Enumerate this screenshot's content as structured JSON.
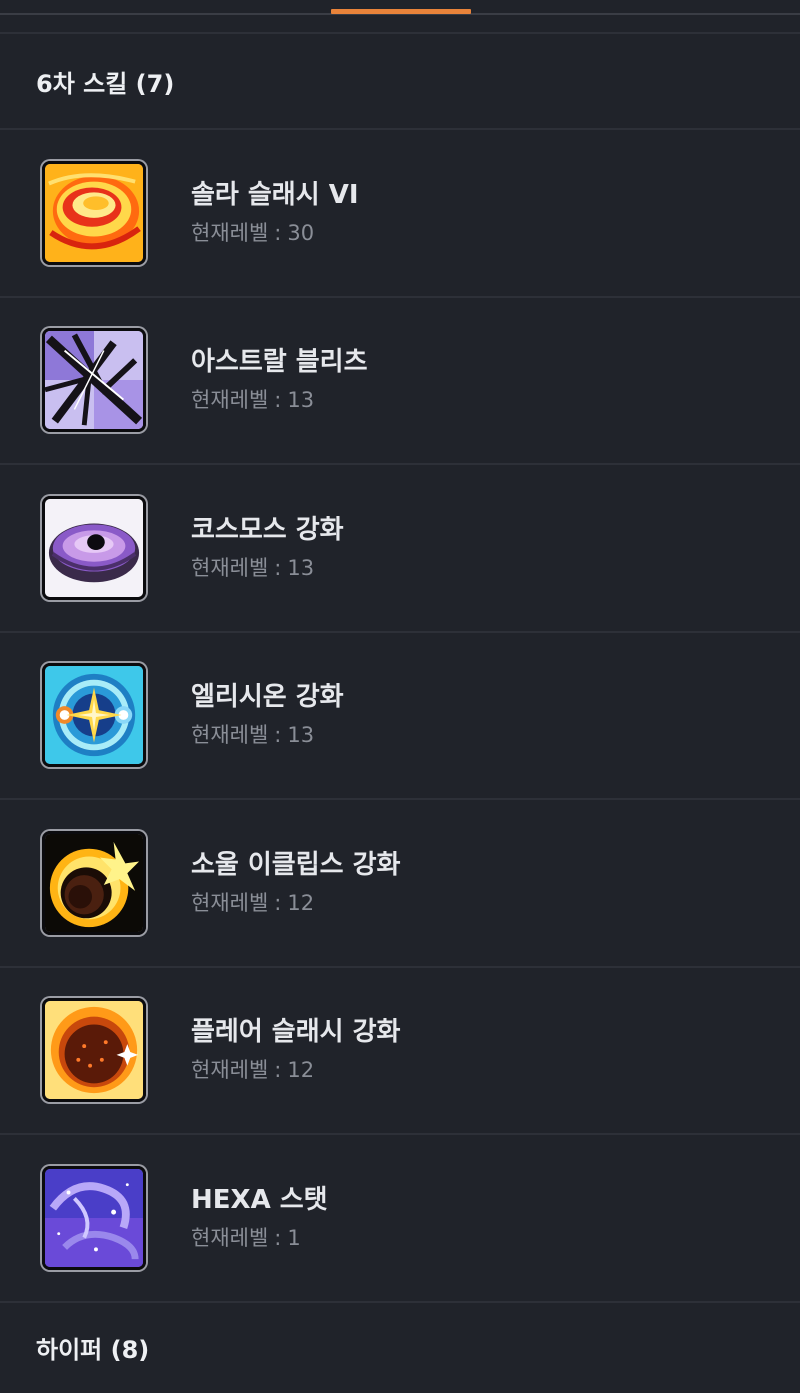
{
  "tabs": {
    "active_color": "#e8833a"
  },
  "section6": {
    "title": "6차 스킬 (7)",
    "skills": [
      {
        "name": "솔라 슬래시 VI",
        "level_label": "현재레벨",
        "level": "30",
        "icon": "solar-slash-icon"
      },
      {
        "name": "아스트랄 블리츠",
        "level_label": "현재레벨",
        "level": "13",
        "icon": "astral-blitz-icon"
      },
      {
        "name": "코스모스 강화",
        "level_label": "현재레벨",
        "level": "13",
        "icon": "cosmos-icon"
      },
      {
        "name": "엘리시온 강화",
        "level_label": "현재레벨",
        "level": "13",
        "icon": "elysion-icon"
      },
      {
        "name": "소울 이클립스 강화",
        "level_label": "현재레벨",
        "level": "12",
        "icon": "soul-eclipse-icon"
      },
      {
        "name": "플레어 슬래시 강화",
        "level_label": "현재레벨",
        "level": "12",
        "icon": "flare-slash-icon"
      },
      {
        "name": "HEXA 스탯",
        "level_label": "현재레벨",
        "level": "1",
        "icon": "hexa-stat-icon"
      }
    ]
  },
  "hyper": {
    "title": "하이퍼 (8)"
  }
}
